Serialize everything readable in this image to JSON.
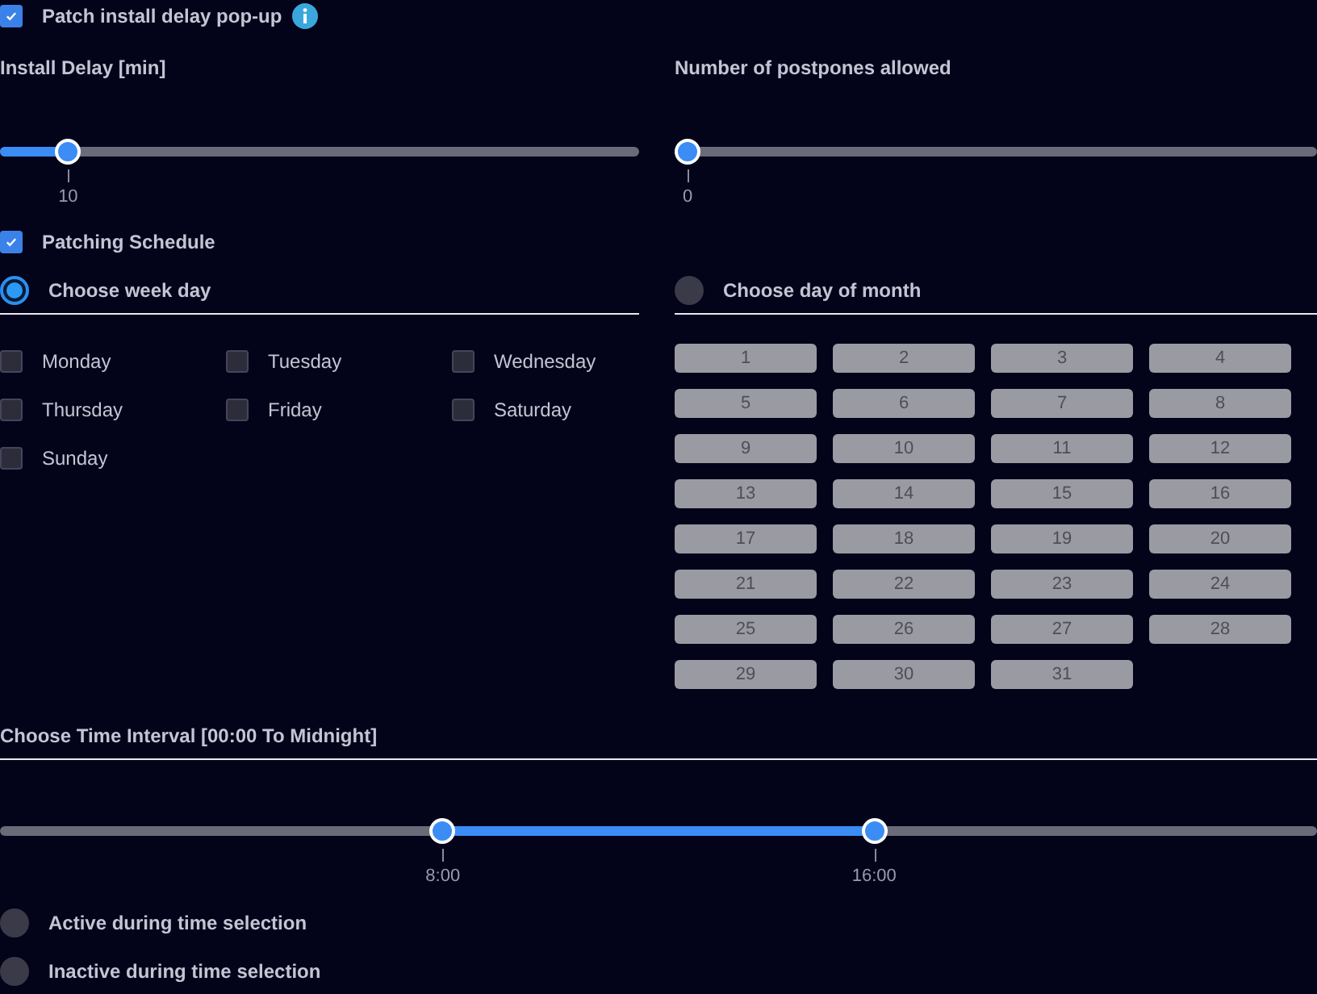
{
  "popup_option": {
    "label": "Patch install delay pop-up",
    "checked": true
  },
  "sliders": [
    {
      "title": "Install Delay [min]",
      "level": 0.09,
      "value": "10"
    },
    {
      "title": "Number of postpones allowed",
      "level": 0,
      "value": "0"
    }
  ],
  "schedule": {
    "label": "Patching Schedule",
    "checked": true
  },
  "week_day": {
    "label": "Choose week day",
    "selected": true,
    "days": [
      {
        "label": "Monday",
        "checked": false
      },
      {
        "label": "Tuesday",
        "checked": false
      },
      {
        "label": "Wednesday",
        "checked": false
      },
      {
        "label": "Thursday",
        "checked": false
      },
      {
        "label": "Friday",
        "checked": false
      },
      {
        "label": "Saturday",
        "checked": false
      },
      {
        "label": "Sunday",
        "checked": false
      }
    ]
  },
  "month_day": {
    "label": "Choose day of month",
    "selected": false,
    "disabled": true,
    "days": [
      "1",
      "2",
      "3",
      "4",
      "5",
      "6",
      "7",
      "8",
      "9",
      "10",
      "11",
      "12",
      "13",
      "14",
      "15",
      "16",
      "17",
      "18",
      "19",
      "20",
      "21",
      "22",
      "23",
      "24",
      "25",
      "26",
      "27",
      "28",
      "29",
      "30",
      "31"
    ]
  },
  "time_interval": {
    "title": "Choose Time Interval [00:00 To Midnight]",
    "handles": [
      {
        "label": "8:00",
        "level": 0.333
      },
      {
        "label": "16:00",
        "level": 0.667
      }
    ]
  },
  "time_modes": [
    {
      "label": "Active during time selection",
      "selected": false
    },
    {
      "label": "Inactive during time selection",
      "selected": false
    }
  ]
}
